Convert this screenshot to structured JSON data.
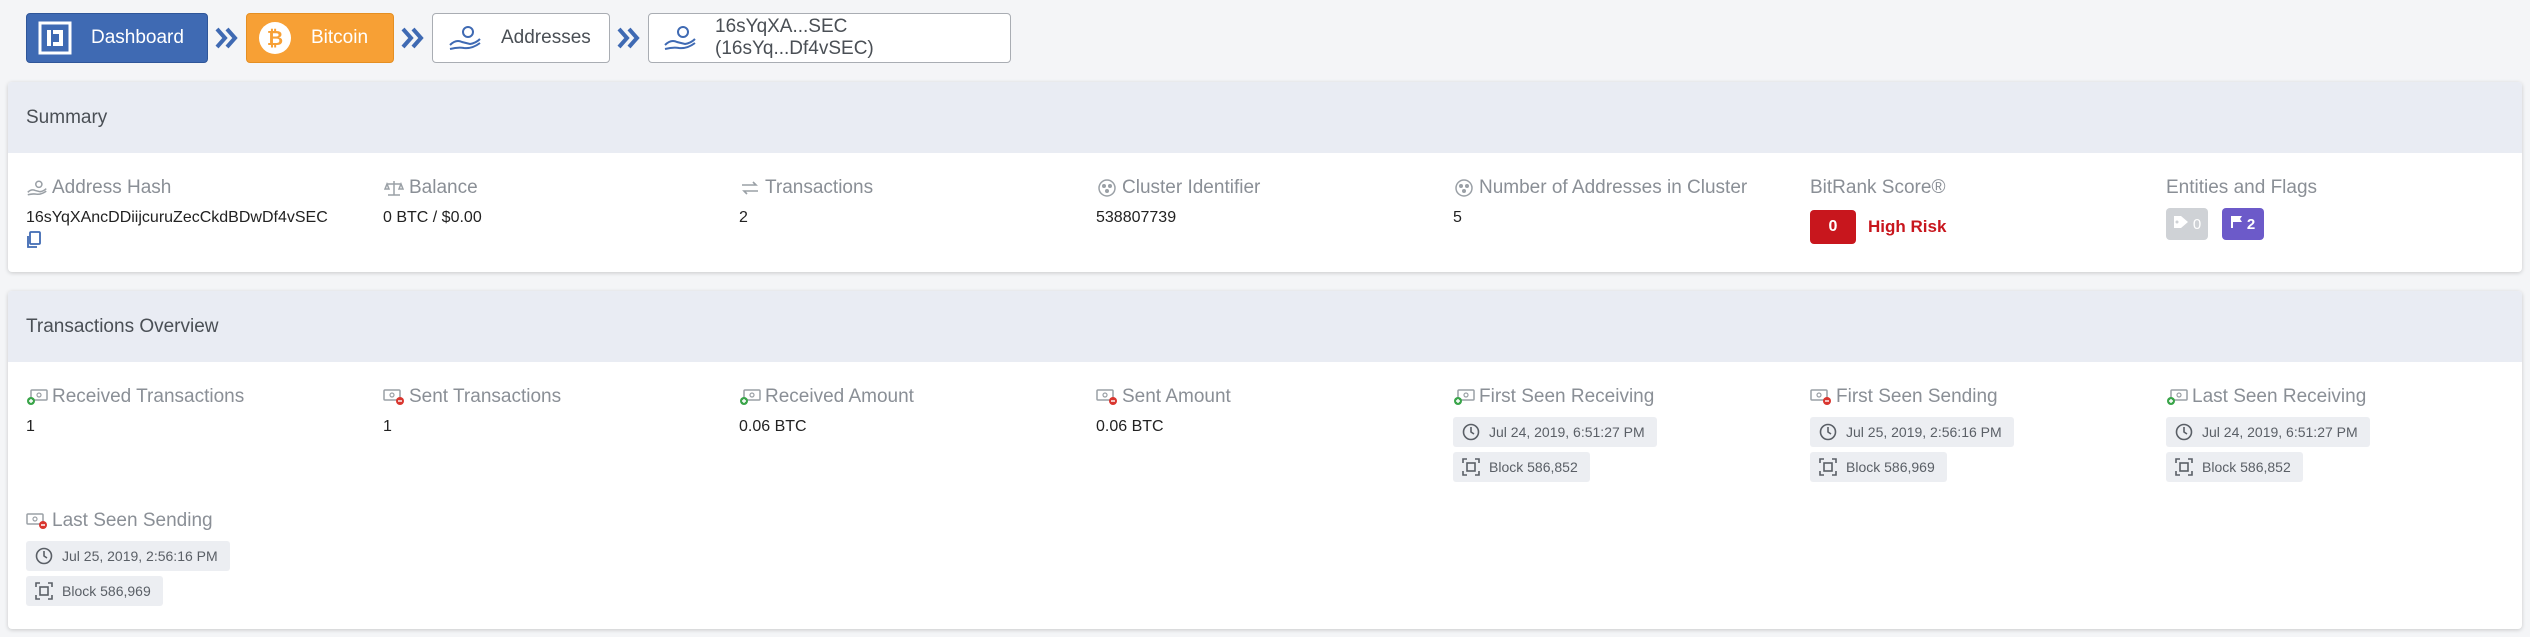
{
  "breadcrumb": {
    "dashboard": "Dashboard",
    "bitcoin": "Bitcoin",
    "addresses": "Addresses",
    "address": "16sYqXA...SEC (16sYq...Df4vSEC)"
  },
  "summary": {
    "title": "Summary",
    "address_hash": {
      "label": "Address Hash",
      "value": "16sYqXAncDDiijcuruZecCkdBDwDf4vSEC"
    },
    "balance": {
      "label": "Balance",
      "value": "0 BTC / $0.00"
    },
    "transactions": {
      "label": "Transactions",
      "value": "2"
    },
    "cluster_identifier": {
      "label": "Cluster Identifier",
      "value": "538807739"
    },
    "cluster_addresses": {
      "label": "Number of Addresses in Cluster",
      "value": "5"
    },
    "bitrank": {
      "label": "BitRank Score®",
      "score": "0",
      "risk": "High Risk"
    },
    "entities": {
      "label": "Entities and Flags",
      "tags": "0",
      "flags": "2"
    }
  },
  "overview": {
    "title": "Transactions Overview",
    "received_tx": {
      "label": "Received Transactions",
      "value": "1"
    },
    "sent_tx": {
      "label": "Sent Transactions",
      "value": "1"
    },
    "received_amount": {
      "label": "Received Amount",
      "value": "0.06 BTC"
    },
    "sent_amount": {
      "label": "Sent Amount",
      "value": "0.06 BTC"
    },
    "first_seen_receiving": {
      "label": "First Seen Receiving",
      "time": "Jul 24, 2019, 6:51:27 PM",
      "block": "Block 586,852"
    },
    "first_seen_sending": {
      "label": "First Seen Sending",
      "time": "Jul 25, 2019, 2:56:16 PM",
      "block": "Block 586,969"
    },
    "last_seen_receiving": {
      "label": "Last Seen Receiving",
      "time": "Jul 24, 2019, 6:51:27 PM",
      "block": "Block 586,852"
    },
    "last_seen_sending": {
      "label": "Last Seen Sending",
      "time": "Jul 25, 2019, 2:56:16 PM",
      "block": "Block 586,969"
    }
  },
  "colors": {
    "dashboard": "#3f6ab3",
    "bitcoin": "#f7a035",
    "risk": "#c8161d",
    "flag": "#6c5ac9",
    "tag": "#cfd2d6"
  },
  "icons": {
    "dashboard": "dashboard-logo-icon",
    "bitcoin": "bitcoin-icon",
    "addresses": "address-hand-icon",
    "separator": "double-chevron-right-icon",
    "copy": "copy-icon",
    "clock": "clock-icon",
    "block": "block-icon",
    "tag": "tag-icon",
    "flag": "flag-icon"
  }
}
